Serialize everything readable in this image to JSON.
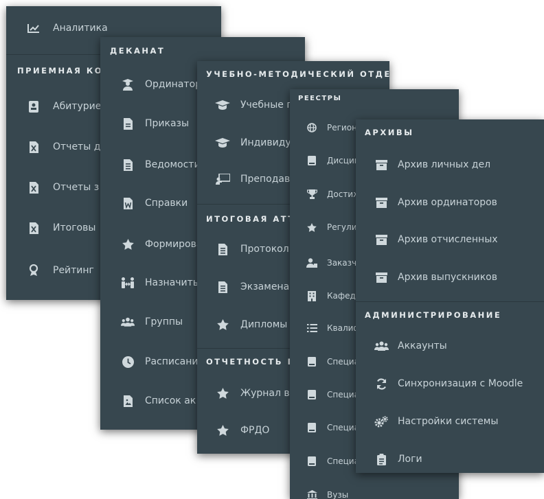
{
  "panel1": {
    "top_item": {
      "label": "Аналитика",
      "icon": "chart-line-icon"
    },
    "section": "ПРИЕМНАЯ КОМИССИЯ",
    "items": [
      {
        "label": "Абитуриенты",
        "icon": "id-card-icon"
      },
      {
        "label": "Отчеты для",
        "icon": "excel-file-icon"
      },
      {
        "label": "Отчеты з",
        "icon": "excel-file-icon"
      },
      {
        "label": "Итоговы",
        "icon": "excel-file-icon"
      },
      {
        "label": "Рейтинг",
        "icon": "award-icon"
      }
    ]
  },
  "panel2": {
    "section": "ДЕКАНАТ",
    "items": [
      {
        "label": "Ординаторы",
        "icon": "graduate-user-icon"
      },
      {
        "label": "Приказы",
        "icon": "file-icon"
      },
      {
        "label": "Ведомости",
        "icon": "file-lines-icon"
      },
      {
        "label": "Справки",
        "icon": "word-file-icon"
      },
      {
        "label": "Формирование",
        "icon": "star-icon"
      },
      {
        "label": "Назначить",
        "icon": "people-arrows-icon"
      },
      {
        "label": "Группы",
        "icon": "users-icon"
      },
      {
        "label": "Расписание",
        "icon": "clock-icon"
      },
      {
        "label": "Список ак",
        "icon": "file-image-icon"
      }
    ]
  },
  "panel3": {
    "sections": [
      {
        "title": "УЧЕБНО-МЕТОДИЧЕСКИЙ ОТДЕЛ",
        "items": [
          {
            "label": "Учебные планы",
            "icon": "graduation-cap-icon"
          },
          {
            "label": "Индивидуальные",
            "icon": "graduation-cap-icon"
          },
          {
            "label": "Преподаватели",
            "icon": "chalkboard-teacher-icon"
          }
        ]
      },
      {
        "title": "ИТОГОВАЯ АТТЕСТАЦИЯ",
        "items": [
          {
            "label": "Протокол",
            "icon": "file-lines-icon"
          },
          {
            "label": "Экзаменационные",
            "icon": "file-lines-icon"
          },
          {
            "label": "Дипломы",
            "icon": "star-icon"
          }
        ]
      },
      {
        "title": "ОТЧЕТНОСТЬ П",
        "items": [
          {
            "label": "Журнал вы",
            "icon": "star-icon"
          },
          {
            "label": "ФРДО",
            "icon": "star-icon"
          }
        ]
      }
    ]
  },
  "panel4": {
    "section": "РЕЕСТРЫ",
    "items": [
      {
        "label": "Регионы",
        "icon": "globe-icon"
      },
      {
        "label": "Дисциплины",
        "icon": "book-icon"
      },
      {
        "label": "Достижения",
        "icon": "trophy-icon"
      },
      {
        "label": "Регулирование",
        "icon": "star-icon"
      },
      {
        "label": "Заказчики",
        "icon": "user-tie-icon"
      },
      {
        "label": "Кафедры",
        "icon": "building-icon"
      },
      {
        "label": "Квалификации",
        "icon": "list-icon"
      },
      {
        "label": "Специальности",
        "icon": "book-icon"
      },
      {
        "label": "Специальности",
        "icon": "book-icon"
      },
      {
        "label": "Специальности",
        "icon": "book-icon"
      },
      {
        "label": "Специальности",
        "icon": "book-icon"
      },
      {
        "label": "Вузы",
        "icon": "university-icon"
      }
    ]
  },
  "panel5": {
    "sections": [
      {
        "title": "АРХИВЫ",
        "items": [
          {
            "label": "Архив личных дел",
            "icon": "archive-icon"
          },
          {
            "label": "Архив ординаторов",
            "icon": "archive-icon"
          },
          {
            "label": "Архив отчисленных",
            "icon": "archive-icon"
          },
          {
            "label": "Архив выпускников",
            "icon": "archive-icon"
          }
        ]
      },
      {
        "title": "АДМИНИСТРИРОВАНИЕ",
        "items": [
          {
            "label": "Аккаунты",
            "icon": "users-icon"
          },
          {
            "label": "Синхронизация с Moodle",
            "icon": "sync-icon"
          },
          {
            "label": "Настройки системы",
            "icon": "gears-icon"
          },
          {
            "label": "Логи",
            "icon": "clipboard-list-icon"
          }
        ]
      }
    ]
  },
  "colors": {
    "panel_bg": "#37474f",
    "text": "#c8d3d8",
    "section_text": "#e6ebed",
    "icon": "#cfd8dc"
  }
}
